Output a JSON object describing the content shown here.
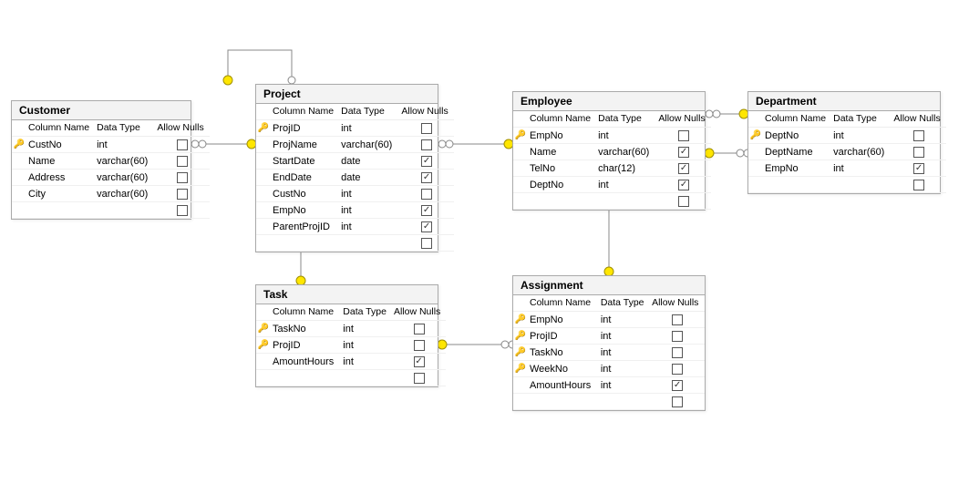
{
  "diagram_type": "database-relationship-diagram",
  "columns_header": {
    "name": "Column Name",
    "type": "Data Type",
    "nulls": "Allow Nulls"
  },
  "tables": {
    "customer": {
      "title": "Customer",
      "rows": [
        {
          "pk": true,
          "name": "CustNo",
          "type": "int",
          "nulls": false
        },
        {
          "pk": false,
          "name": "Name",
          "type": "varchar(60)",
          "nulls": false
        },
        {
          "pk": false,
          "name": "Address",
          "type": "varchar(60)",
          "nulls": false
        },
        {
          "pk": false,
          "name": "City",
          "type": "varchar(60)",
          "nulls": false
        }
      ],
      "trailing_blank_row": true
    },
    "project": {
      "title": "Project",
      "rows": [
        {
          "pk": true,
          "name": "ProjID",
          "type": "int",
          "nulls": false
        },
        {
          "pk": false,
          "name": "ProjName",
          "type": "varchar(60)",
          "nulls": false
        },
        {
          "pk": false,
          "name": "StartDate",
          "type": "date",
          "nulls": true
        },
        {
          "pk": false,
          "name": "EndDate",
          "type": "date",
          "nulls": true
        },
        {
          "pk": false,
          "name": "CustNo",
          "type": "int",
          "nulls": false
        },
        {
          "pk": false,
          "name": "EmpNo",
          "type": "int",
          "nulls": true
        },
        {
          "pk": false,
          "name": "ParentProjID",
          "type": "int",
          "nulls": true
        }
      ],
      "trailing_blank_row": true
    },
    "employee": {
      "title": "Employee",
      "rows": [
        {
          "pk": true,
          "name": "EmpNo",
          "type": "int",
          "nulls": false
        },
        {
          "pk": false,
          "name": "Name",
          "type": "varchar(60)",
          "nulls": true
        },
        {
          "pk": false,
          "name": "TelNo",
          "type": "char(12)",
          "nulls": true
        },
        {
          "pk": false,
          "name": "DeptNo",
          "type": "int",
          "nulls": true
        }
      ],
      "trailing_blank_row": true
    },
    "department": {
      "title": "Department",
      "rows": [
        {
          "pk": true,
          "name": "DeptNo",
          "type": "int",
          "nulls": false
        },
        {
          "pk": false,
          "name": "DeptName",
          "type": "varchar(60)",
          "nulls": false
        },
        {
          "pk": false,
          "name": "EmpNo",
          "type": "int",
          "nulls": true
        }
      ],
      "trailing_blank_row": true
    },
    "task": {
      "title": "Task",
      "rows": [
        {
          "pk": true,
          "name": "TaskNo",
          "type": "int",
          "nulls": false
        },
        {
          "pk": true,
          "name": "ProjID",
          "type": "int",
          "nulls": false
        },
        {
          "pk": false,
          "name": "AmountHours",
          "type": "int",
          "nulls": true
        }
      ],
      "trailing_blank_row": true
    },
    "assignment": {
      "title": "Assignment",
      "rows": [
        {
          "pk": true,
          "name": "EmpNo",
          "type": "int",
          "nulls": false
        },
        {
          "pk": true,
          "name": "ProjID",
          "type": "int",
          "nulls": false
        },
        {
          "pk": true,
          "name": "TaskNo",
          "type": "int",
          "nulls": false
        },
        {
          "pk": true,
          "name": "WeekNo",
          "type": "int",
          "nulls": false
        },
        {
          "pk": false,
          "name": "AmountHours",
          "type": "int",
          "nulls": true
        }
      ],
      "trailing_blank_row": true
    }
  },
  "relationships": [
    {
      "from": "Customer.CustNo",
      "to": "Project.CustNo"
    },
    {
      "from": "Project.ProjID",
      "to": "Project.ParentProjID",
      "self": true
    },
    {
      "from": "Employee.EmpNo",
      "to": "Project.EmpNo"
    },
    {
      "from": "Department.DeptNo",
      "to": "Employee.DeptNo"
    },
    {
      "from": "Employee.EmpNo",
      "to": "Department.EmpNo"
    },
    {
      "from": "Project.ProjID",
      "to": "Task.ProjID"
    },
    {
      "from": "Employee.EmpNo",
      "to": "Assignment.EmpNo"
    },
    {
      "from": "Task.TaskNo+Task.ProjID",
      "to": "Assignment.TaskNo+Assignment.ProjID"
    }
  ]
}
